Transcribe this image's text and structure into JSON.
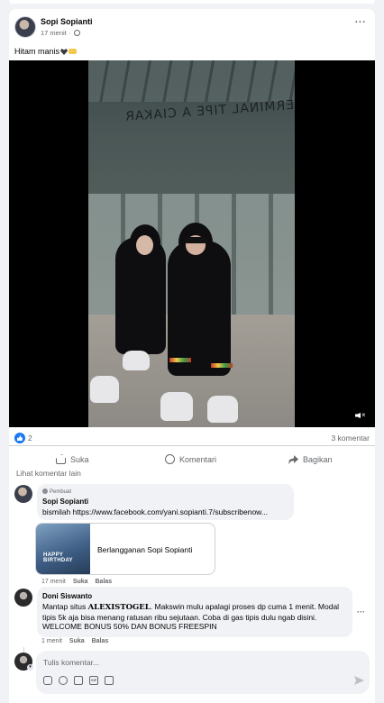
{
  "post": {
    "author": "Sopi Sopianti",
    "time": "17 menit",
    "visibility_separator": "·",
    "caption": "Hitam manis",
    "more_label": "···"
  },
  "video": {
    "sign_text": "TERMINAL TIPE A CIAKAR",
    "muted": true
  },
  "stats": {
    "reaction_count": "2",
    "comment_count": "3 komentar"
  },
  "actions": {
    "like": "Suka",
    "comment": "Komentari",
    "share": "Bagikan"
  },
  "comments_section": {
    "see_more": "Lihat komentar lain",
    "comments": [
      {
        "badge": "Pembuat",
        "author": "Sopi Sopianti",
        "text": "bismilah https://www.facebook.com/yani.sopianti.7/subscribenow...",
        "link_card": {
          "title": "Berlangganan Sopi Sopianti",
          "thumb_text": "HAPPY BIRTHDAY"
        },
        "time": "17 menit",
        "like": "Suka",
        "reply": "Balas"
      },
      {
        "author": "Doni Siswanto",
        "text_before": "Mantap situs ",
        "brand": "ALEXISTOGEL",
        "text_after": ". Makswin mulu apalagi proses dp cuma 1 menit. Modal tipis 5k aja bisa menang ratusan ribu sejutaan. Coba di gas tipis dulu ngab disini. WELCOME BONUS 50% DAN BONUS FREESPIN",
        "more_label": "···",
        "time": "1 menit",
        "like": "Suka",
        "reply": "Balas"
      }
    ]
  },
  "composer": {
    "placeholder": "Tulis komentar...",
    "tools": [
      "sticker-icon",
      "emoji-icon",
      "camera-icon",
      "gif-icon",
      "frame-icon"
    ],
    "send_icon": "send-icon"
  },
  "colors": {
    "accent": "#1877f2",
    "background": "#f0f2f5",
    "secondary_text": "#65676b"
  }
}
